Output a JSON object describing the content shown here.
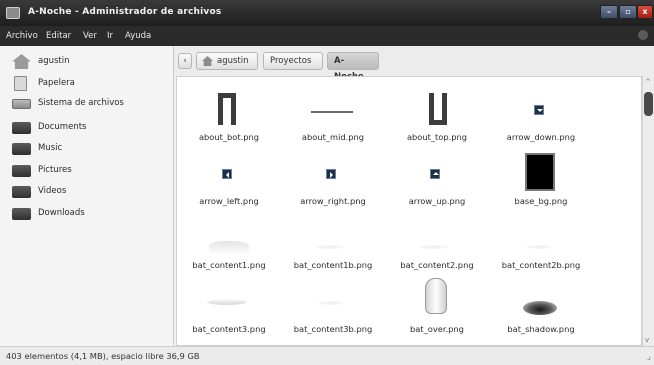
{
  "window": {
    "title": "A-Noche - Administrador de archivos",
    "buttons": {
      "minimize": "–",
      "maximize": "▫",
      "close": "x"
    }
  },
  "menubar": {
    "items": [
      {
        "label": "Archivo"
      },
      {
        "label": "Editar"
      },
      {
        "label": "Ver"
      },
      {
        "label": "Ir"
      },
      {
        "label": "Ayuda"
      }
    ]
  },
  "sidebar": {
    "items": [
      {
        "label": "agustin",
        "icon": "home-icon"
      },
      {
        "label": "Papelera",
        "icon": "trash-icon"
      },
      {
        "label": "Sistema de archivos",
        "icon": "drive-icon"
      },
      {
        "label": "Documents",
        "icon": "folder-icon"
      },
      {
        "label": "Music",
        "icon": "folder-icon"
      },
      {
        "label": "Pictures",
        "icon": "folder-icon"
      },
      {
        "label": "Videos",
        "icon": "folder-icon"
      },
      {
        "label": "Downloads",
        "icon": "folder-icon"
      }
    ]
  },
  "location": {
    "back": "‹",
    "crumbs": [
      {
        "label": "agustin"
      },
      {
        "label": "Proyectos"
      },
      {
        "label": "A-Noche"
      }
    ]
  },
  "files": [
    {
      "name": "about_bot.png"
    },
    {
      "name": "about_mid.png"
    },
    {
      "name": "about_top.png"
    },
    {
      "name": "arrow_down.png"
    },
    {
      "name": "arrow_left.png"
    },
    {
      "name": "arrow_right.png"
    },
    {
      "name": "arrow_up.png"
    },
    {
      "name": "base_bg.png"
    },
    {
      "name": "bat_content1.png"
    },
    {
      "name": "bat_content1b.png"
    },
    {
      "name": "bat_content2.png"
    },
    {
      "name": "bat_content2b.png"
    },
    {
      "name": "bat_content3.png"
    },
    {
      "name": "bat_content3b.png"
    },
    {
      "name": "bat_over.png"
    },
    {
      "name": "bat_shadow.png"
    }
  ],
  "statusbar": {
    "text": "403 elementos (4,1 MB), espacio libre 36,9 GB"
  }
}
